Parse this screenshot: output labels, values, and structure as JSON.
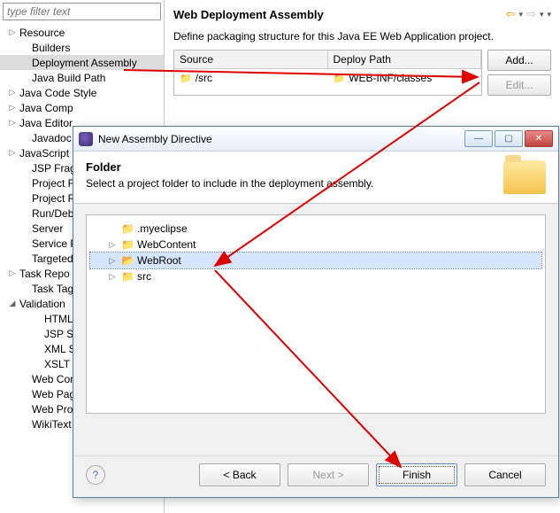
{
  "filter": {
    "placeholder": "type filter text"
  },
  "tree": [
    {
      "label": "Resource",
      "tw": "▷",
      "lvl": 0
    },
    {
      "label": "Builders",
      "tw": "",
      "lvl": 1
    },
    {
      "label": "Deployment Assembly",
      "tw": "",
      "lvl": 1,
      "sel": true
    },
    {
      "label": "Java Build Path",
      "tw": "",
      "lvl": 1
    },
    {
      "label": "Java Code Style",
      "tw": "▷",
      "lvl": 0
    },
    {
      "label": "Java Comp",
      "tw": "▷",
      "lvl": 0
    },
    {
      "label": "Java Editor",
      "tw": "▷",
      "lvl": 0
    },
    {
      "label": "Javadoc Loc",
      "tw": "",
      "lvl": 1
    },
    {
      "label": "JavaScript",
      "tw": "▷",
      "lvl": 0
    },
    {
      "label": "JSP Fragme",
      "tw": "",
      "lvl": 1
    },
    {
      "label": "Project Fac",
      "tw": "",
      "lvl": 1
    },
    {
      "label": "Project Ref",
      "tw": "",
      "lvl": 1
    },
    {
      "label": "Run/Debug",
      "tw": "",
      "lvl": 1
    },
    {
      "label": "Server",
      "tw": "",
      "lvl": 1
    },
    {
      "label": "Service Pol",
      "tw": "",
      "lvl": 1
    },
    {
      "label": "Targeted R",
      "tw": "",
      "lvl": 1
    },
    {
      "label": "Task Repo",
      "tw": "▷",
      "lvl": 0
    },
    {
      "label": "Task Tags",
      "tw": "",
      "lvl": 1
    },
    {
      "label": "Validation",
      "tw": "◢",
      "lvl": 0
    },
    {
      "label": "HTML S",
      "tw": "",
      "lvl": 2
    },
    {
      "label": "JSP Syn",
      "tw": "",
      "lvl": 2
    },
    {
      "label": "XML Sy",
      "tw": "",
      "lvl": 2
    },
    {
      "label": "XSLT Va",
      "tw": "",
      "lvl": 2
    },
    {
      "label": "Web Conte",
      "tw": "",
      "lvl": 1
    },
    {
      "label": "Web Page",
      "tw": "",
      "lvl": 1
    },
    {
      "label": "Web Proje",
      "tw": "",
      "lvl": 1
    },
    {
      "label": "WikiText",
      "tw": "",
      "lvl": 1
    }
  ],
  "right": {
    "title": "Web Deployment Assembly",
    "desc": "Define packaging structure for this Java EE Web Application project.",
    "cols": {
      "source": "Source",
      "deploy": "Deploy Path"
    },
    "row": {
      "source": "/src",
      "deploy": "WEB-INF/classes"
    },
    "buttons": {
      "add": "Add...",
      "edit": "Edit..."
    }
  },
  "dialog": {
    "title": "New Assembly Directive",
    "header": "Folder",
    "sub": "Select a project folder to include in the deployment assembly.",
    "folders": [
      {
        "label": ".myeclipse",
        "exp": "",
        "sel": false,
        "icon": "cf"
      },
      {
        "label": "WebContent",
        "exp": "▷",
        "sel": false,
        "icon": "cf"
      },
      {
        "label": "WebRoot",
        "exp": "▷",
        "sel": true,
        "icon": "of"
      },
      {
        "label": "src",
        "exp": "▷",
        "sel": false,
        "icon": "cf"
      }
    ],
    "buttons": {
      "back": "< Back",
      "next": "Next >",
      "finish": "Finish",
      "cancel": "Cancel"
    },
    "help": "?",
    "win": {
      "min": "—",
      "max": "▢",
      "close": "✕"
    }
  }
}
